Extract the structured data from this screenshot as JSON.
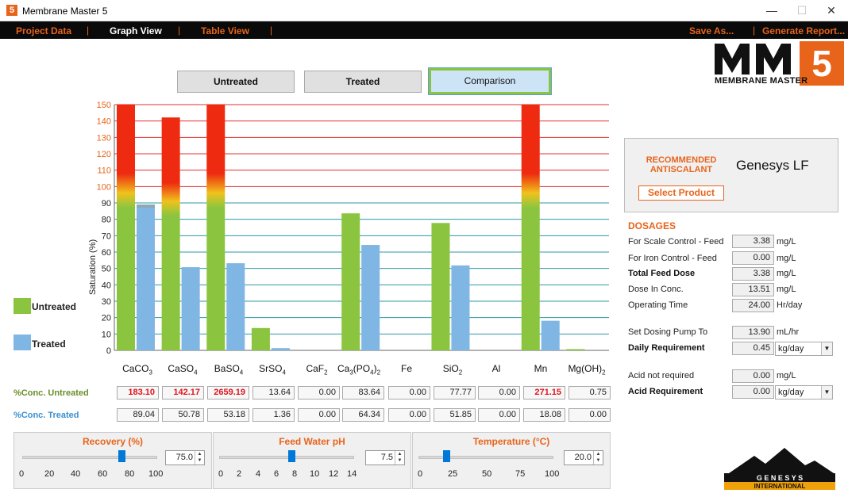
{
  "window": {
    "icon": "5",
    "title": "Membrane Master 5",
    "minimize": "—",
    "maximize": "☐",
    "close": "✕"
  },
  "menu": {
    "project_data": "Project Data",
    "graph_view": "Graph View",
    "table_view": "Table View",
    "separator": "|",
    "save_as": "Save As...",
    "generate_report": "Generate Report..."
  },
  "logo": {
    "mm": "MM",
    "five": "5",
    "subtitle": "MEMBRANE MASTER",
    "genesys": "G E N E S Y S",
    "international": "INTERNATIONAL"
  },
  "view_buttons": {
    "untreated": "Untreated",
    "treated": "Treated",
    "comparison": "Comparison"
  },
  "colors": {
    "untreated": "#8bc53f",
    "treated": "#7fb6e4",
    "danger": "#ee2a10",
    "accent": "#e8641b",
    "selected_btn": "#cde4f7"
  },
  "chart_data": {
    "type": "bar",
    "ylabel": "Saturation (%)",
    "ylim": [
      0,
      150
    ],
    "yticks": [
      "0",
      "10",
      "20",
      "30",
      "40",
      "50",
      "60",
      "70",
      "80",
      "90",
      "100",
      "110",
      "120",
      "130",
      "140",
      "150"
    ],
    "categories": [
      "CaCO3",
      "CaSO4",
      "BaSO4",
      "SrSO4",
      "CaF2",
      "Ca3(PO4)2",
      "Fe",
      "SiO2",
      "Al",
      "Mn",
      "Mg(OH)2"
    ],
    "series": [
      {
        "name": "Untreated",
        "values": [
          150,
          142.17,
          150,
          13.64,
          0,
          83.64,
          0,
          77.77,
          0,
          150,
          0.75
        ]
      },
      {
        "name": "Treated",
        "values": [
          89.04,
          50.78,
          53.18,
          1.36,
          0,
          64.34,
          0,
          51.85,
          0,
          18.08,
          0
        ]
      }
    ],
    "grid": "horizontal, red above 100, teal at or below 100",
    "legend": "left"
  },
  "category_labels": [
    {
      "base": "CaCO",
      "sub": "3",
      "rest": "",
      "sub2": ""
    },
    {
      "base": "CaSO",
      "sub": "4",
      "rest": "",
      "sub2": ""
    },
    {
      "base": "BaSO",
      "sub": "4",
      "rest": "",
      "sub2": ""
    },
    {
      "base": "SrSO",
      "sub": "4",
      "rest": "",
      "sub2": ""
    },
    {
      "base": "CaF",
      "sub": "2",
      "rest": "",
      "sub2": ""
    },
    {
      "base": "Ca",
      "sub": "3",
      "rest": "(PO",
      "sub2": "4",
      "rest2": ")",
      "sub3": "2"
    },
    {
      "base": "Fe",
      "sub": "",
      "rest": "",
      "sub2": ""
    },
    {
      "base": "SiO",
      "sub": "2",
      "rest": "",
      "sub2": ""
    },
    {
      "base": "Al",
      "sub": "",
      "rest": "",
      "sub2": ""
    },
    {
      "base": "Mn",
      "sub": "",
      "rest": "",
      "sub2": ""
    },
    {
      "base": "Mg(OH)",
      "sub": "2",
      "rest": "",
      "sub2": ""
    }
  ],
  "legend": {
    "untreated": "Untreated",
    "treated": "Treated"
  },
  "conc": {
    "untreated_label": "%Conc. Untreated",
    "treated_label": "%Conc. Treated",
    "untreated": [
      "183.10",
      "142.17",
      "2659.19",
      "13.64",
      "0.00",
      "83.64",
      "0.00",
      "77.77",
      "0.00",
      "271.15",
      "0.75"
    ],
    "untreated_high": [
      true,
      true,
      true,
      false,
      false,
      false,
      false,
      false,
      false,
      true,
      false
    ],
    "treated": [
      "89.04",
      "50.78",
      "53.18",
      "1.36",
      "0.00",
      "64.34",
      "0.00",
      "51.85",
      "0.00",
      "18.08",
      "0.00"
    ]
  },
  "sliders": {
    "recovery": {
      "title": "Recovery (%)",
      "value": "75.0",
      "ticks": [
        "0",
        "20",
        "40",
        "60",
        "80",
        "100"
      ],
      "level": 0.75
    },
    "ph": {
      "title": "Feed Water pH",
      "value": "7.5",
      "ticks": [
        "0",
        "2",
        "4",
        "6",
        "8",
        "10",
        "12",
        "14"
      ],
      "level": 0.536
    },
    "temperature": {
      "title": "Temperature (°C)",
      "value": "20.0",
      "ticks": [
        "0",
        "25",
        "50",
        "75",
        "100"
      ],
      "level": 0.2
    }
  },
  "recommended": {
    "label_line1": "RECOMMENDED",
    "label_line2": "ANTISCALANT",
    "product": "Genesys LF",
    "select_button": "Select Product"
  },
  "dosages": {
    "title": "DOSAGES",
    "scale_feed": {
      "label": "For Scale Control - Feed",
      "value": "3.38",
      "unit": "mg/L"
    },
    "iron_feed": {
      "label": "For Iron Control - Feed",
      "value": "0.00",
      "unit": "mg/L"
    },
    "total_feed": {
      "label": "Total Feed Dose",
      "value": "3.38",
      "unit": "mg/L"
    },
    "dose_conc": {
      "label": "Dose In Conc.",
      "value": "13.51",
      "unit": "mg/L"
    },
    "operating": {
      "label": "Operating Time",
      "value": "24.00",
      "unit": "Hr/day"
    },
    "pump": {
      "label": "Set Dosing Pump To",
      "value": "13.90",
      "unit": "mL/hr"
    },
    "daily": {
      "label": "Daily Requirement",
      "value": "0.45",
      "unit": "kg/day"
    },
    "acid_not": {
      "label": "Acid not required",
      "value": "0.00",
      "unit": "mg/L"
    },
    "acid_req": {
      "label": "Acid Requirement",
      "value": "0.00",
      "unit": "kg/day"
    }
  }
}
